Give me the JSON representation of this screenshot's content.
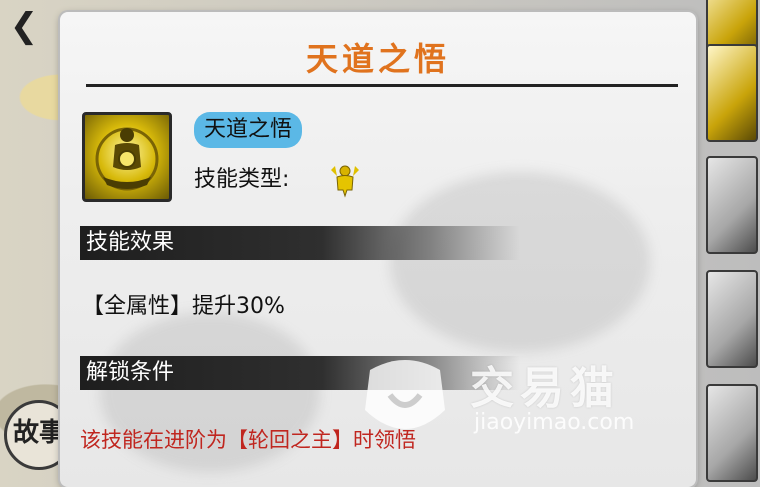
{
  "dialog": {
    "title": "天道之悟",
    "skill_name": "天道之悟",
    "skill_type_label": "技能类型:",
    "skill_type_icon": "golden-figure-icon",
    "effect_header": "技能效果",
    "effect_text": "【全属性】提升30%",
    "unlock_header": "解锁条件",
    "unlock_text": "该技能在进阶为【轮回之主】时领悟"
  },
  "background": {
    "story_label": "故事"
  },
  "watermark": {
    "brand_cn": "交易猫",
    "brand_en": "jiaoyimao.com"
  },
  "colors": {
    "title": "#e0731e",
    "badge": "#5bb8e6",
    "unlock_text": "#c0261f"
  }
}
